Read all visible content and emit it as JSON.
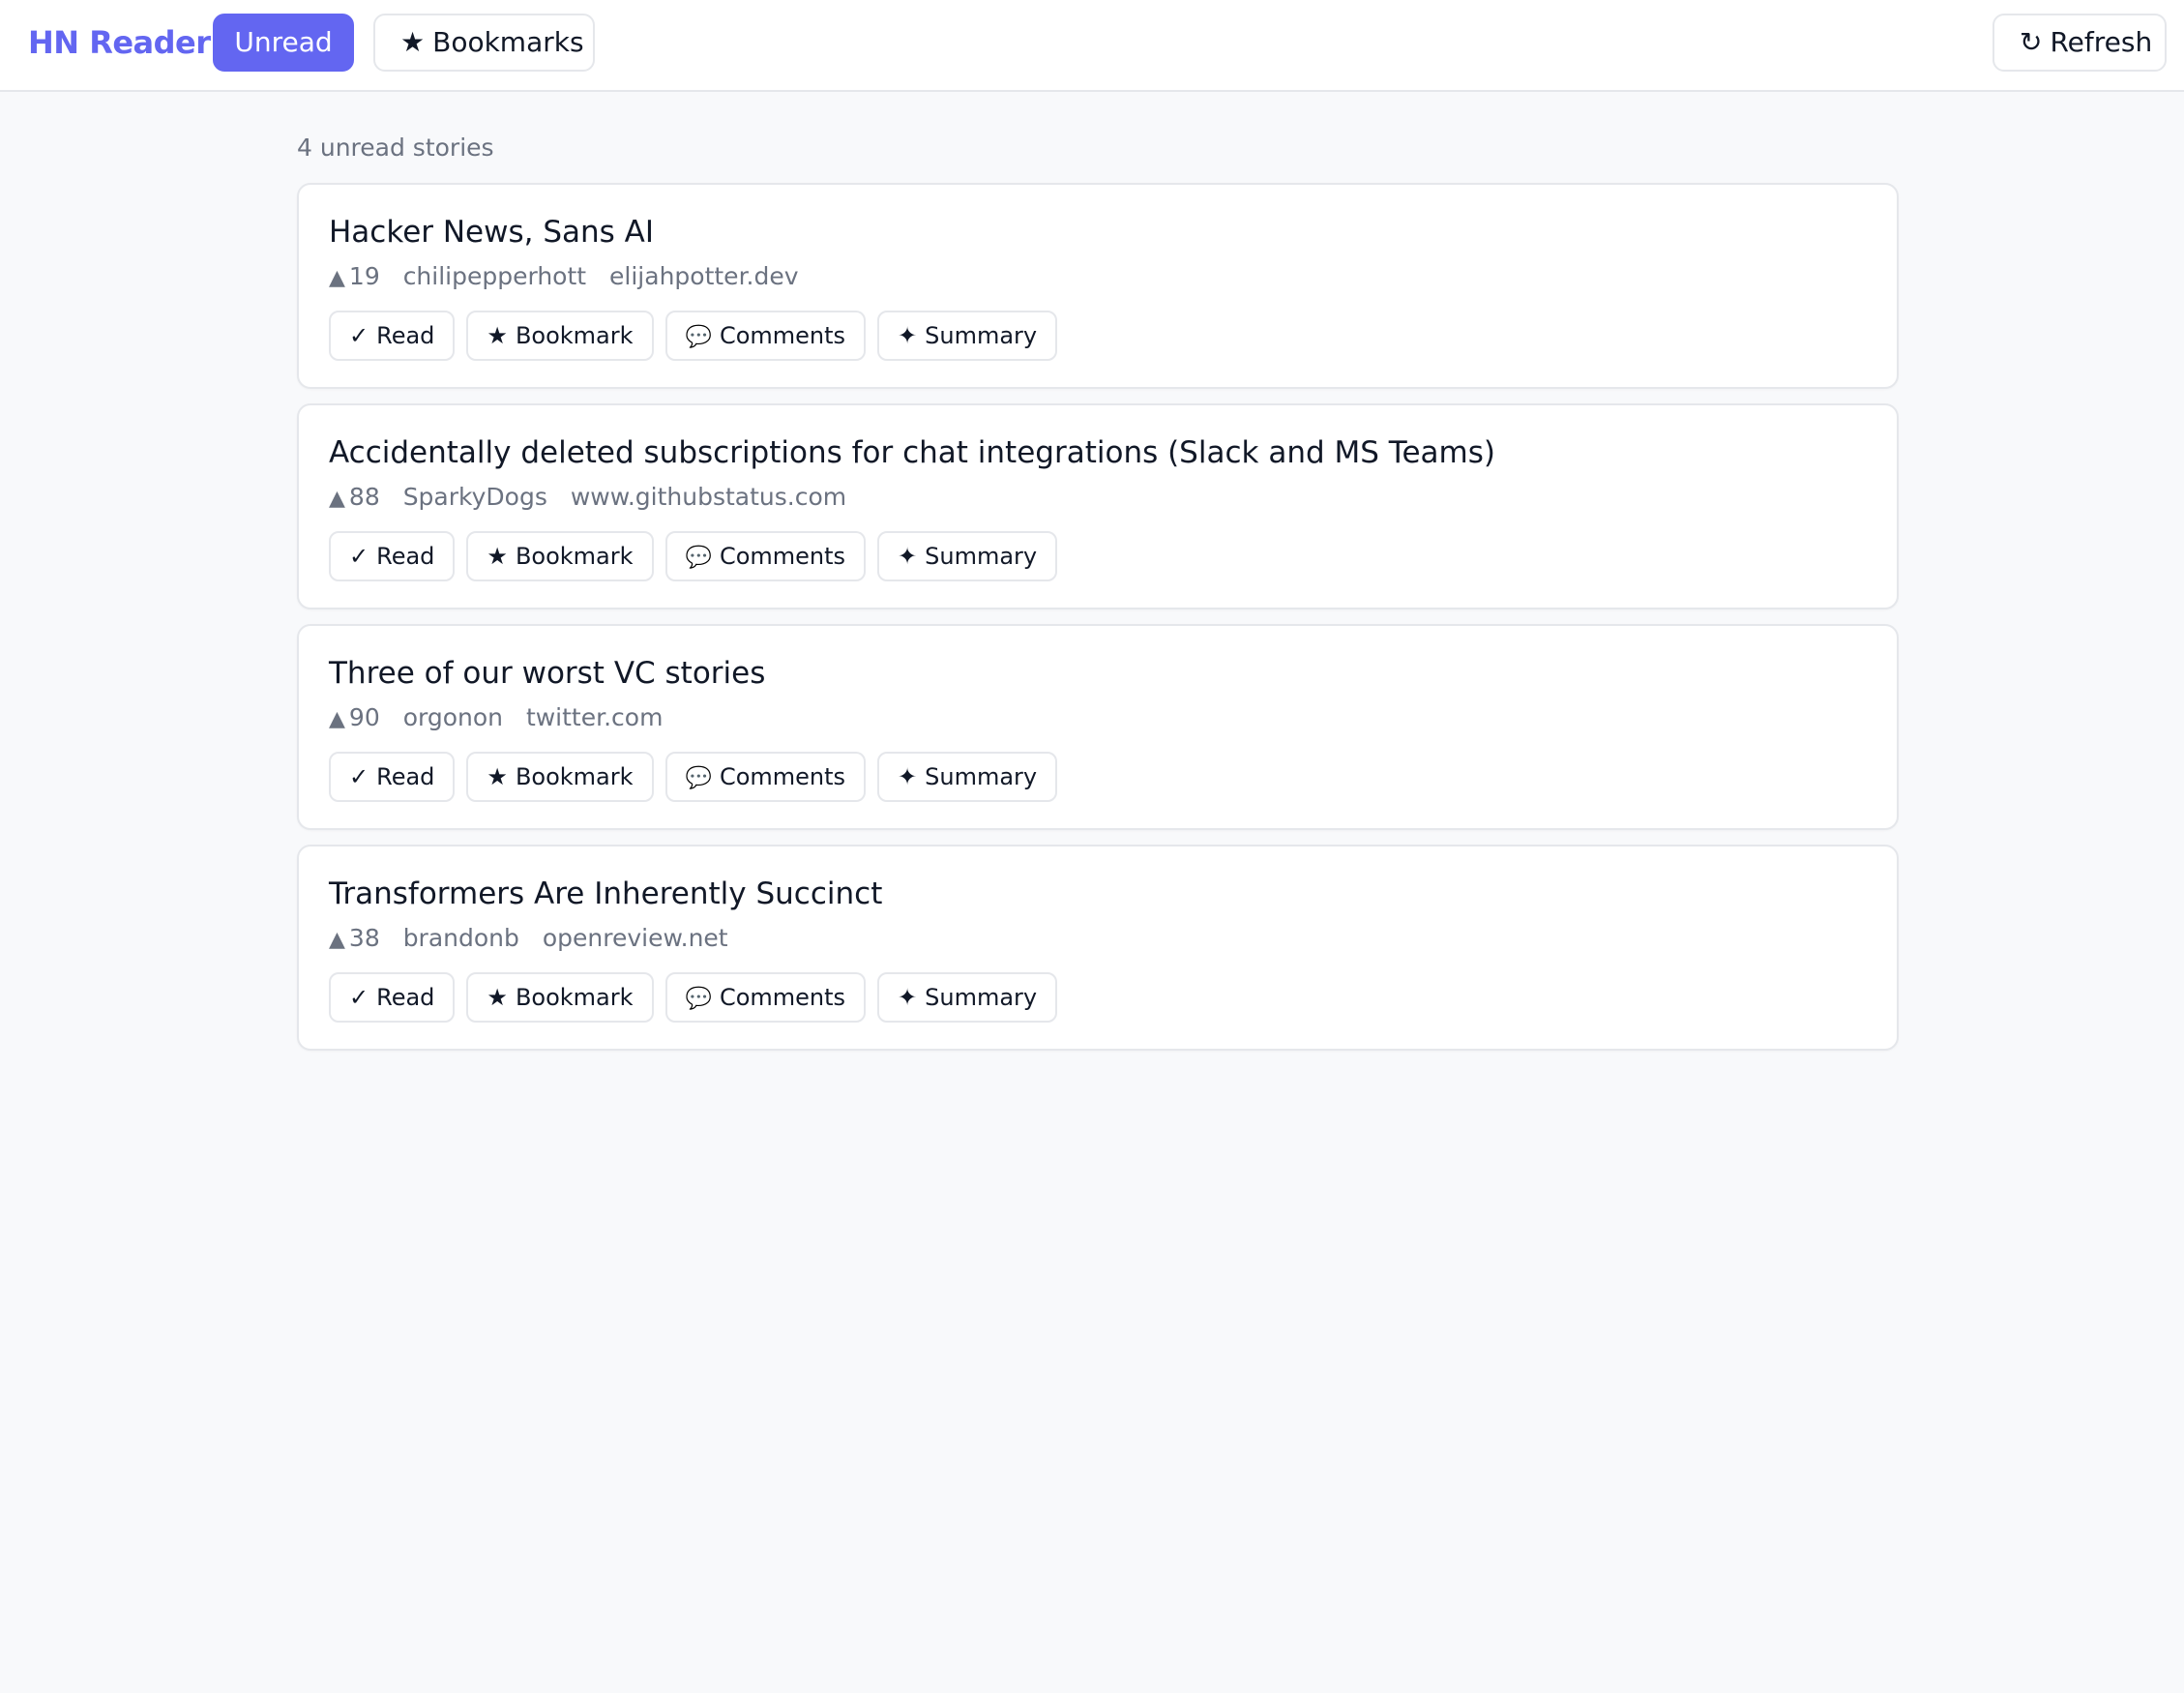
{
  "app": {
    "brand": "HN Reader",
    "accent_color": "#6366f1"
  },
  "nav": {
    "unread_label": "Unread",
    "bookmarks_label": "Bookmarks",
    "bookmarks_icon": "star-icon",
    "refresh_label": "Refresh",
    "refresh_icon": "refresh-icon"
  },
  "summary": {
    "count_text": "4 unread stories"
  },
  "actions": {
    "read_label": "Read",
    "read_icon": "check-icon",
    "bookmark_label": "Bookmark",
    "bookmark_icon": "star-icon",
    "comments_label": "Comments",
    "comments_icon": "speech-bubble-icon",
    "summary_label": "Summary",
    "summary_icon": "sparkle-icon"
  },
  "stories": [
    {
      "title": "Hacker News, Sans AI",
      "points": "19",
      "author": "chilipepperhott",
      "domain": "elijahpotter.dev"
    },
    {
      "title": "Accidentally deleted subscriptions for chat integrations (Slack and MS Teams)",
      "points": "88",
      "author": "SparkyDogs",
      "domain": "www.githubstatus.com"
    },
    {
      "title": "Three of our worst VC stories",
      "points": "90",
      "author": "orgonon",
      "domain": "twitter.com"
    },
    {
      "title": "Transformers Are Inherently Succinct",
      "points": "38",
      "author": "brandonb",
      "domain": "openreview.net"
    }
  ]
}
